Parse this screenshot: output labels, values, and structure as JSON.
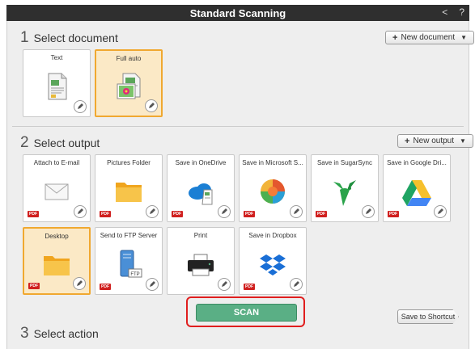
{
  "window": {
    "title": "Standard Scanning",
    "back_glyph": "<",
    "help_glyph": "?"
  },
  "sections": {
    "document": {
      "number": "1",
      "label": "Select document",
      "new_button": "New document"
    },
    "output": {
      "number": "2",
      "label": "Select output",
      "new_button": "New output"
    },
    "action": {
      "number": "3",
      "label": "Select action"
    }
  },
  "documents": [
    {
      "label": "Text",
      "icon": "text-document-icon",
      "selected": false
    },
    {
      "label": "Full auto",
      "icon": "photo-document-icon",
      "selected": true
    }
  ],
  "outputs": [
    {
      "label": "Attach to E-mail",
      "icon": "envelope-icon",
      "badge": "PDF",
      "selected": false
    },
    {
      "label": "Pictures Folder",
      "icon": "folder-icon",
      "badge": "PDF",
      "selected": false
    },
    {
      "label": "Save in OneDrive",
      "icon": "onedrive-icon",
      "badge": "PDF",
      "selected": false
    },
    {
      "label": "Save in Microsoft S...",
      "icon": "sharepoint-icon",
      "badge": "PDF",
      "selected": false
    },
    {
      "label": "Save in SugarSync",
      "icon": "sugarsync-icon",
      "badge": "PDF",
      "selected": false
    },
    {
      "label": "Save in Google Dri...",
      "icon": "google-drive-icon",
      "badge": "PDF",
      "selected": false
    },
    {
      "label": "Desktop",
      "icon": "folder-icon",
      "badge": "PDF",
      "selected": true
    },
    {
      "label": "Send to FTP Server",
      "icon": "ftp-server-icon",
      "badge": "PDF",
      "selected": false
    },
    {
      "label": "Print",
      "icon": "printer-icon",
      "badge": "",
      "selected": false
    },
    {
      "label": "Save in Dropbox",
      "icon": "dropbox-icon",
      "badge": "PDF",
      "selected": false
    }
  ],
  "actions": {
    "scan_label": "SCAN",
    "shortcut_label": "Save to Shortcut"
  },
  "colors": {
    "accent_selected": "#f0a830",
    "scan_green": "#5aaf85",
    "highlight_red": "#e01e1e",
    "pdf_badge": "#d0201f"
  }
}
